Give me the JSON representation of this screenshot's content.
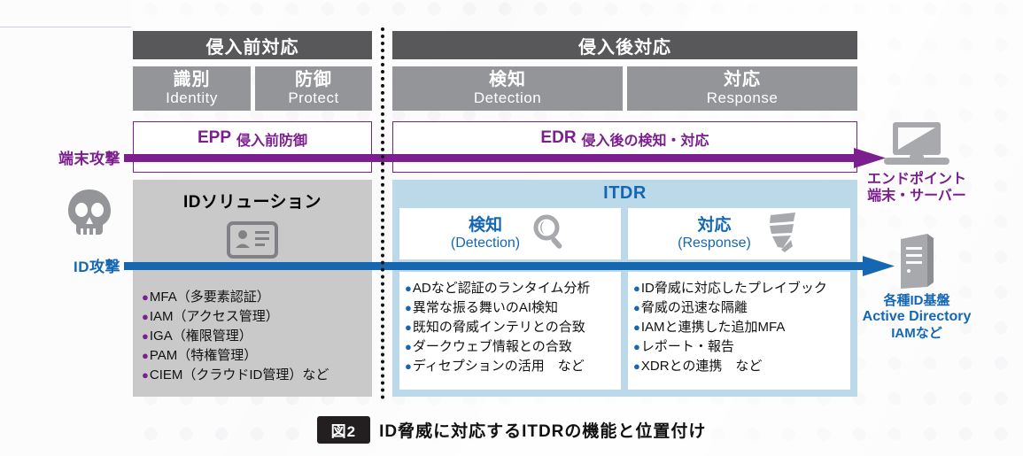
{
  "figure": {
    "badge": "図2",
    "caption": "ID脅威に対応するITDRの機能と位置付け"
  },
  "phases": [
    {
      "id": "pre",
      "label": "侵入前対応"
    },
    {
      "id": "post",
      "label": "侵入後対応"
    }
  ],
  "functions": [
    {
      "id": "identify",
      "jp": "識別",
      "en": "Identity"
    },
    {
      "id": "protect",
      "jp": "防御",
      "en": "Protect"
    },
    {
      "id": "detect",
      "jp": "検知",
      "en": "Detection"
    },
    {
      "id": "respond",
      "jp": "対応",
      "en": "Response"
    }
  ],
  "products": [
    {
      "id": "epp",
      "name": "EPP",
      "desc": "侵入前防御"
    },
    {
      "id": "edr",
      "name": "EDR",
      "desc": "侵入後の検知・対応"
    }
  ],
  "id_solution": {
    "title": "IDソリューション",
    "icon": "id-card-icon",
    "items": [
      "MFA（多要素認証）",
      "IAM（アクセス管理）",
      "IGA（権限管理）",
      "PAM（特権管理）",
      "CIEM（クラウドID管理）など"
    ]
  },
  "itdr": {
    "title": "ITDR",
    "columns": [
      {
        "id": "detection",
        "jp": "検知",
        "en": "(Detection)",
        "icon": "magnifier-icon",
        "items": [
          "ADなど認証のランタイム分析",
          "異常な振る舞いのAI検知",
          "既知の脅威インテリとの合致",
          "ダークウェブ情報との合致",
          "ディセプションの活用　など"
        ]
      },
      {
        "id": "response",
        "jp": "対応",
        "en": "(Response)",
        "icon": "megaphone-icon",
        "items": [
          "ID脅威に対応したプレイブック",
          "脅威の迅速な隔離",
          "IAMと連携した追加MFA",
          "レポート・報告",
          "XDRとの連携　など"
        ]
      }
    ]
  },
  "attacks": [
    {
      "id": "endpoint-attack",
      "label": "端末攻撃",
      "color": "#7b1f8e"
    },
    {
      "id": "id-attack",
      "label": "ID攻撃",
      "color": "#1567b2"
    }
  ],
  "threat_actor": {
    "icon": "skull-icon"
  },
  "targets": [
    {
      "id": "endpoint",
      "icon": "laptop-icon",
      "lines": [
        "エンドポイント",
        "端末・サーバー"
      ],
      "color": "#7b1f8e"
    },
    {
      "id": "identity-infra",
      "icon": "server-icon",
      "lines": [
        "各種ID基盤",
        "Active Directory",
        "IAMなど"
      ],
      "color": "#1567b2"
    }
  ],
  "colors": {
    "header_dark": "#58585a",
    "header_mid": "#939598",
    "purple": "#7b1f8e",
    "blue": "#1567b2",
    "itdr_bg": "#bcd9ea",
    "idsol_bg": "#c9c9c9"
  }
}
